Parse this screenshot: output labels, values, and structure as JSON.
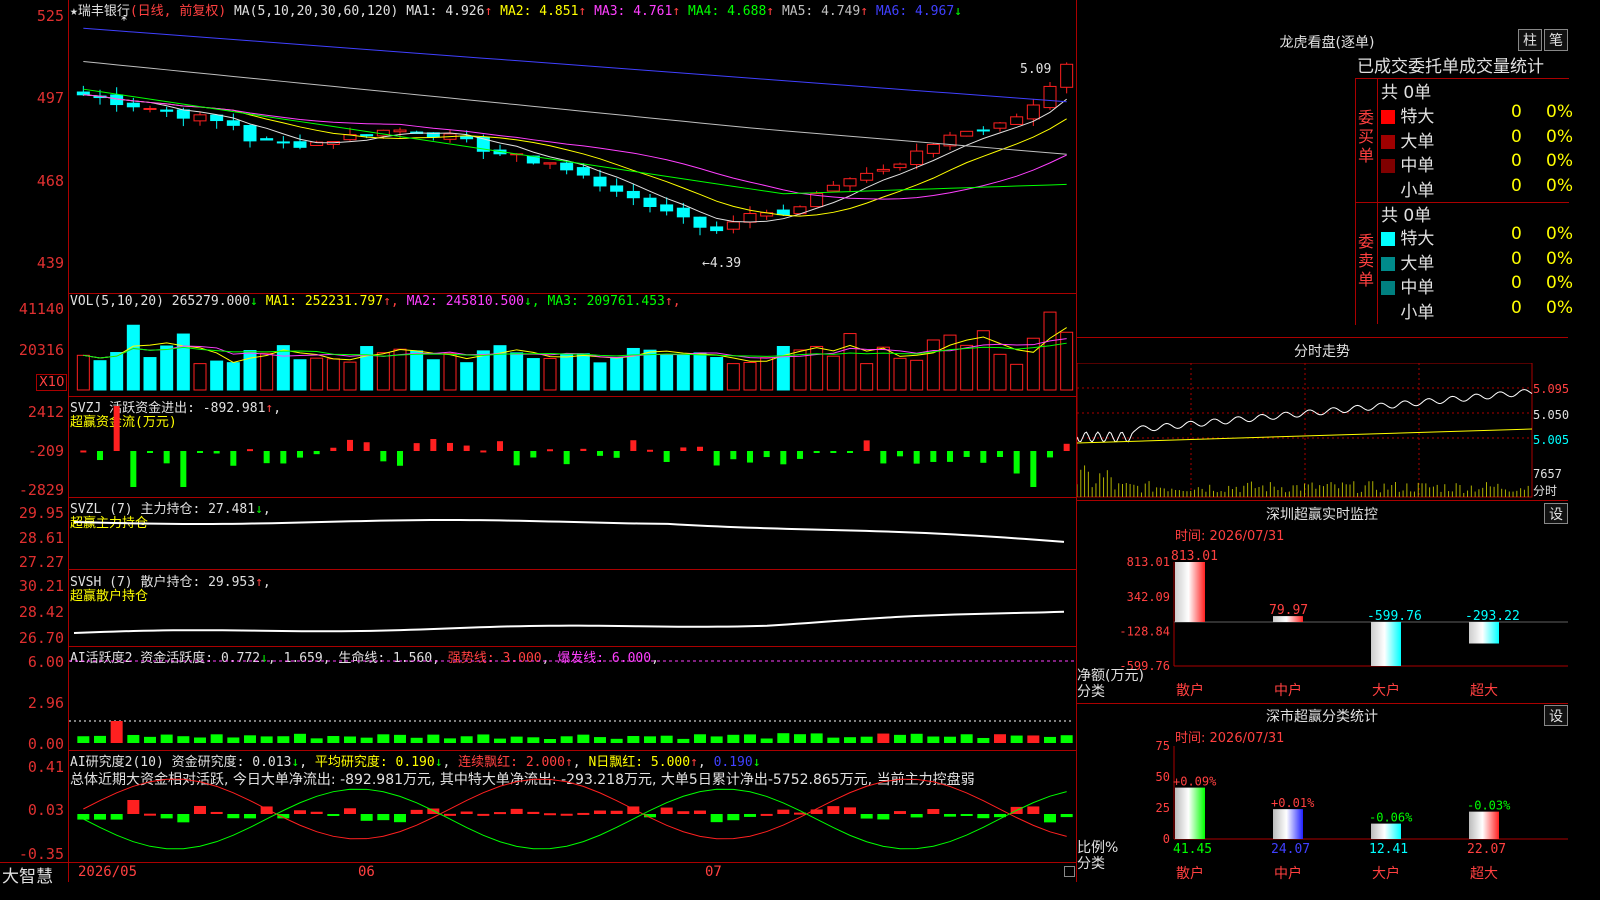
{
  "stock": {
    "name": "瑞丰银行",
    "mode": "(日线, 前复权)",
    "ma_spec": "MA(5,10,20,30,60,120)",
    "ma": [
      {
        "label": "MA1:",
        "value": "4.926",
        "arrow": "↑",
        "color": "#e0e0e0"
      },
      {
        "label": "MA2:",
        "value": "4.851",
        "arrow": "↑",
        "color": "#ffff00"
      },
      {
        "label": "MA3:",
        "value": "4.761",
        "arrow": "↑",
        "color": "#ff40ff"
      },
      {
        "label": "MA4:",
        "value": "4.688",
        "arrow": "↑",
        "color": "#00ff00"
      },
      {
        "label": "MA5:",
        "value": "4.749",
        "arrow": "↑",
        "color": "#c0c0c0"
      },
      {
        "label": "MA6:",
        "value": "4.967",
        "arrow": "↓",
        "color": "#4040ff"
      }
    ],
    "price_axis": [
      "525",
      "497",
      "468",
      "439"
    ],
    "high_label": "5.09",
    "low_label": "←4.39"
  },
  "vol": {
    "header": "VOL(5,10,20)",
    "vol_value": "265279.000",
    "vol_arrow": "↓",
    "ma": [
      {
        "label": "MA1:",
        "value": "252231.797",
        "arrow": "↑",
        "color": "#ffff00"
      },
      {
        "label": "MA2:",
        "value": "245810.500",
        "arrow": "↓",
        "color": "#ff40ff"
      },
      {
        "label": "MA3:",
        "value": "209761.453",
        "arrow": "↑",
        "color": "#00ff00"
      }
    ],
    "axis": [
      "41140",
      "20316"
    ],
    "unit": "X10"
  },
  "svzj": {
    "header": "SVZJ  活跃资金进出: -892.981",
    "arrow": "↑",
    "sub": "超赢资金流(万元)",
    "axis": [
      "2412",
      "-209",
      "-2829"
    ]
  },
  "svzl": {
    "header": "SVZL (7) 主力持仓: 27.481",
    "arrow": "↓",
    "sub": "超赢主力持仓",
    "axis": [
      "29.95",
      "28.61",
      "27.27"
    ]
  },
  "svsh": {
    "header": "SVSH (7) 散户持仓: 29.953",
    "arrow": "↑",
    "sub": "超赢散户持仓",
    "axis": [
      "30.21",
      "28.42",
      "26.70"
    ]
  },
  "ai1": {
    "header": "AI活跃度2 资金活跃度: 0.772",
    "a1": "↓",
    "v2": "1.659",
    "v3": "生命线: 1.560",
    "v4": "强势线: 3.000",
    "v5": "爆发线: 6.000",
    "axis": [
      "6.00",
      "2.96",
      "0.00"
    ]
  },
  "ai2": {
    "header": "AI研究度2(10) 资金研究度: 0.013",
    "a1": "↓",
    "v2": "平均研究度: 0.190",
    "a2": "↓",
    "v3": "连续飘红: 2.000",
    "a3": "↑",
    "v4": "N日飘红: 5.000",
    "a4": "↑",
    "v5": "0.190",
    "a5": "↓",
    "summary": "总体近期大资金相对活跃, 今日大单净流出: -892.981万元, 其中特大单净流出: -293.218万元, 大单5日累计净出-5752.865万元, 当前主力控盘弱",
    "axis": [
      "0.41",
      "0.03",
      "-0.35"
    ]
  },
  "footer": {
    "brand": "大智慧",
    "dates": [
      "2026/05",
      "06",
      "07"
    ]
  },
  "right": {
    "dragon_title": "龙虎看盘(逐单)",
    "btn1": "柱",
    "btn2": "笔",
    "tabs": "已成交委托单成交量统计",
    "buy": {
      "side": "委买单",
      "total": "共 0单",
      "rows": [
        {
          "label": "特大",
          "n": "0",
          "p": "0%",
          "color": "#ff0000"
        },
        {
          "label": "大单",
          "n": "0",
          "p": "0%",
          "color": "#a00000"
        },
        {
          "label": "中单",
          "n": "0",
          "p": "0%",
          "color": "#800000"
        },
        {
          "label": "小单",
          "n": "0",
          "p": "0%",
          "color": ""
        }
      ]
    },
    "sell": {
      "side": "委卖单",
      "total": "共 0单",
      "rows": [
        {
          "label": "特大",
          "n": "0",
          "p": "0%",
          "color": "#00ffff"
        },
        {
          "label": "大单",
          "n": "0",
          "p": "0%",
          "color": "#008b8b"
        },
        {
          "label": "中单",
          "n": "0",
          "p": "0%",
          "color": "#008080"
        },
        {
          "label": "小单",
          "n": "0",
          "p": "0%",
          "color": ""
        }
      ]
    },
    "intraday": {
      "title": "分时走势",
      "prices": [
        "5.095",
        "5.050",
        "5.005"
      ],
      "vol": "7657",
      "vol_unit": "分时"
    },
    "monitor": {
      "title": "深圳超赢实时监控",
      "set": "设",
      "time": "时间: 2026/07/31",
      "axis": [
        "813.01",
        "342.09",
        "-128.84",
        "-599.76"
      ],
      "ylabel": "净额(万元)",
      "xlabel": "分类",
      "bars": [
        {
          "cat": "散户",
          "label": "813.01",
          "value": 813.01,
          "label_color": "#ff4040"
        },
        {
          "cat": "中户",
          "label": "79.97",
          "value": 79.97,
          "label_color": "#ff4040"
        },
        {
          "cat": "大户",
          "label": "-599.76",
          "value": -599.76,
          "label_color": "#00ffff"
        },
        {
          "cat": "超大",
          "label": "-293.22",
          "value": -293.22,
          "label_color": "#00ffff"
        }
      ]
    },
    "stats": {
      "title": "深市超赢分类统计",
      "set": "设",
      "time": "时间: 2026/07/31",
      "axis": [
        "75",
        "50",
        "25",
        "0"
      ],
      "ylabel": "比例%",
      "xlabel": "分类",
      "bars": [
        {
          "cat": "散户",
          "pct": "+0.09%",
          "value": 41.45,
          "label": "41.45",
          "pct_color": "#ff4040",
          "val_color": "#00ff00"
        },
        {
          "cat": "中户",
          "pct": "+0.01%",
          "value": 24.07,
          "label": "24.07",
          "pct_color": "#ff4040",
          "val_color": "#4040ff"
        },
        {
          "cat": "大户",
          "pct": "-0.06%",
          "value": 12.41,
          "label": "12.41",
          "pct_color": "#00ff00",
          "val_color": "#00ffff"
        },
        {
          "cat": "超大",
          "pct": "-0.03%",
          "value": 22.07,
          "label": "22.07",
          "pct_color": "#00ff00",
          "val_color": "#ff4040"
        }
      ]
    }
  }
}
